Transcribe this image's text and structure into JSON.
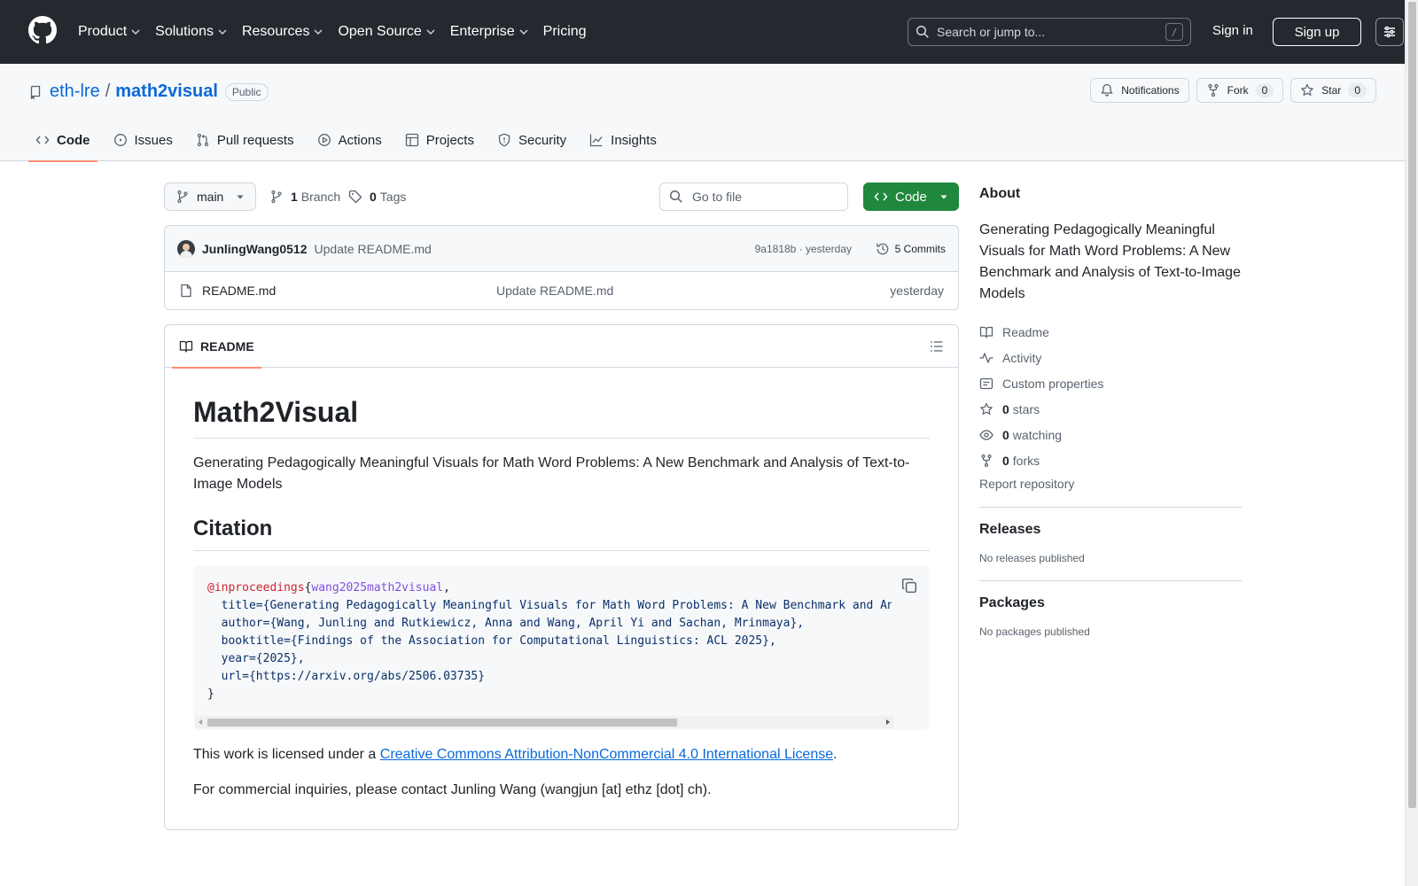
{
  "header": {
    "nav": [
      "Product",
      "Solutions",
      "Resources",
      "Open Source",
      "Enterprise",
      "Pricing"
    ],
    "search_placeholder": "Search or jump to...",
    "search_key": "/",
    "sign_in": "Sign in",
    "sign_up": "Sign up"
  },
  "repo": {
    "owner": "eth-lre",
    "separator": "/",
    "name": "math2visual",
    "visibility": "Public",
    "notifications_label": "Notifications",
    "fork_label": "Fork",
    "fork_count": "0",
    "star_label": "Star",
    "star_count": "0",
    "tabs": [
      "Code",
      "Issues",
      "Pull requests",
      "Actions",
      "Projects",
      "Security",
      "Insights"
    ]
  },
  "toolbar": {
    "branch": "main",
    "branch_count": "1",
    "branch_label": "Branch",
    "tag_count": "0",
    "tag_label": "Tags",
    "go_to_file": "Go to file",
    "code_button": "Code"
  },
  "commit": {
    "author": "JunlingWang0512",
    "message": "Update README.md",
    "meta": "9a1818b · yesterday",
    "commits": "5 Commits"
  },
  "files": [
    {
      "name": "README.md",
      "message": "Update README.md",
      "date": "yesterday"
    }
  ],
  "readme": {
    "tab": "README",
    "title": "Math2Visual",
    "description": "Generating Pedagogically Meaningful Visuals for Math Word Problems: A New Benchmark and Analysis of Text-to-Image Models",
    "citation_heading": "Citation",
    "code": {
      "l1_kw": "@inproceedings",
      "l1_brace": "{",
      "l1_key": "wang2025math2visual",
      "l1_comma": ",",
      "l2": "  title={Generating Pedagogically Meaningful Visuals for Math Word Problems: A New Benchmark and Analysis of Text-to-Image Models},",
      "l3": "  author={Wang, Junling and Rutkiewicz, Anna and Wang, April Yi and Sachan, Mrinmaya},",
      "l4": "  booktitle={Findings of the Association for Computational Linguistics: ACL 2025},",
      "l5": "  year={2025},",
      "l6": "  url={https://arxiv.org/abs/2506.03735}",
      "l7": "}"
    },
    "license_prefix": "This work is licensed under a ",
    "license_link": "Creative Commons Attribution-NonCommercial 4.0 International License",
    "license_suffix": ".",
    "contact": "For commercial inquiries, please contact Junling Wang (wangjun [at] ethz [dot] ch)."
  },
  "about": {
    "heading": "About",
    "description": "Generating Pedagogically Meaningful Visuals for Math Word Problems: A New Benchmark and Analysis of Text-to-Image Models",
    "readme": "Readme",
    "activity": "Activity",
    "custom_properties": "Custom properties",
    "stars_count": "0",
    "stars_label": "stars",
    "watching_count": "0",
    "watching_label": "watching",
    "forks_count": "0",
    "forks_label": "forks",
    "report": "Report repository",
    "releases_heading": "Releases",
    "releases_text": "No releases published",
    "packages_heading": "Packages",
    "packages_text": "No packages published"
  }
}
